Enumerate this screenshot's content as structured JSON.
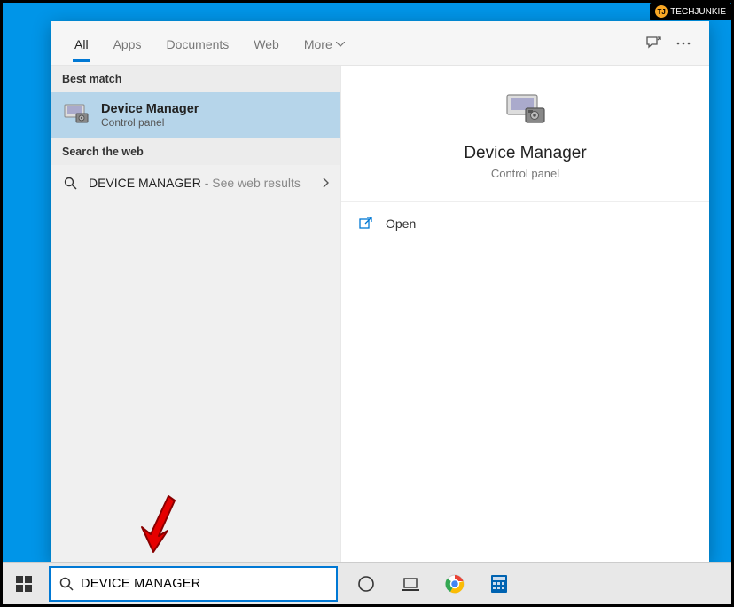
{
  "watermark": {
    "badge": "TJ",
    "text": "TECHJUNKIE"
  },
  "tabs": {
    "items": [
      "All",
      "Apps",
      "Documents",
      "Web",
      "More"
    ],
    "active_index": 0
  },
  "sections": {
    "best_match_header": "Best match",
    "web_header": "Search the web"
  },
  "best_match": {
    "title": "Device Manager",
    "subtitle": "Control panel"
  },
  "web_result": {
    "query": "DEVICE MANAGER",
    "suffix": " - See web results"
  },
  "detail": {
    "title": "Device Manager",
    "subtitle": "Control panel",
    "actions": {
      "open": "Open"
    }
  },
  "taskbar": {
    "search_value": "DEVICE MANAGER"
  }
}
